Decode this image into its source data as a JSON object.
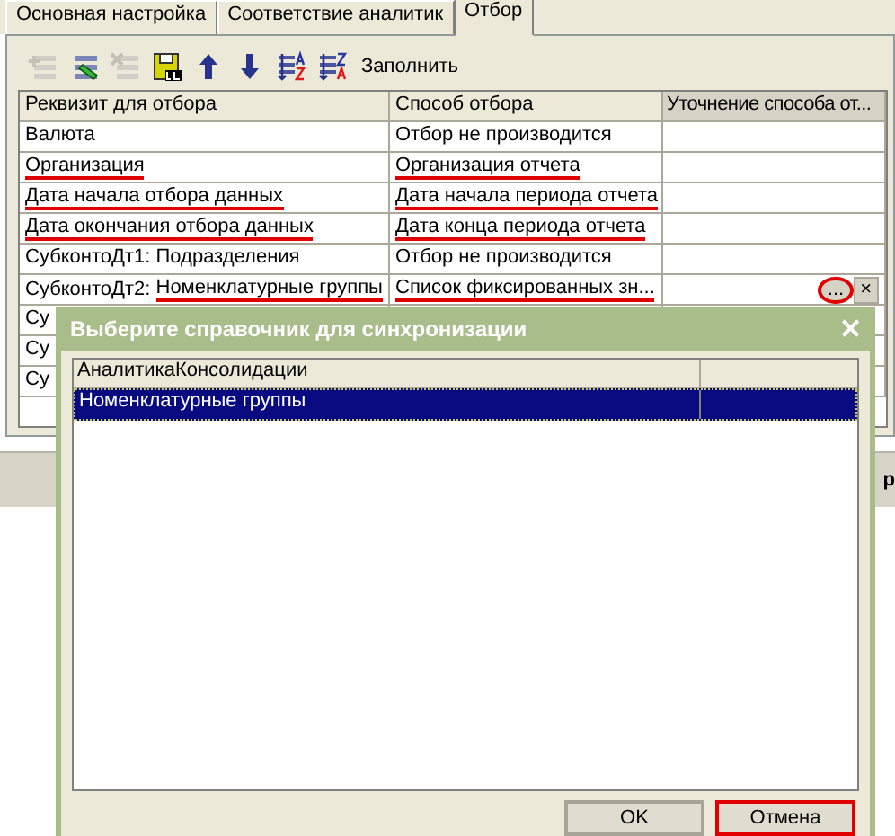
{
  "tabs": [
    {
      "label": "Основная настройка",
      "selected": false
    },
    {
      "label": "Соответствие аналитик",
      "selected": false
    },
    {
      "label": "Отбор",
      "selected": true
    }
  ],
  "toolbar": {
    "buttons": [
      {
        "kind": "add",
        "disabled": true
      },
      {
        "kind": "edit",
        "disabled": false
      },
      {
        "kind": "delete",
        "disabled": true
      },
      {
        "kind": "save",
        "disabled": false
      },
      {
        "kind": "up",
        "disabled": false
      },
      {
        "kind": "down",
        "disabled": false
      },
      {
        "kind": "sort_asc",
        "disabled": false
      },
      {
        "kind": "sort_desc",
        "disabled": false
      }
    ],
    "fill_label": "Заполнить"
  },
  "table": {
    "columns": [
      "Реквизит для отбора",
      "Способ отбора",
      "Уточнение способа от..."
    ],
    "rows": [
      {
        "cells": [
          {
            "text": "Валюта",
            "underlined": false
          },
          {
            "text": "Отбор не производится",
            "underlined": false
          }
        ]
      },
      {
        "cells": [
          {
            "text": "Организация",
            "underlined": true
          },
          {
            "text": "Организация отчета",
            "underlined": true
          }
        ]
      },
      {
        "cells": [
          {
            "text": "Дата начала отбора данных",
            "underlined": true
          },
          {
            "text": "Дата начала периода отчета",
            "underlined": true
          }
        ]
      },
      {
        "cells": [
          {
            "text": "Дата окончания отбора данных",
            "underlined": true
          },
          {
            "text": "Дата конца периода отчета",
            "underlined": true
          }
        ]
      },
      {
        "cells": [
          {
            "text": "СубконтоДт1: Подразделения",
            "underlined": false
          },
          {
            "text": "Отбор не производится",
            "underlined": false
          }
        ]
      },
      {
        "cells": [
          {
            "prefix": "СубконтоДт2:",
            "text": "Номенклатурные группы",
            "underlined": true
          },
          {
            "text": "Список фиксированных зн...",
            "underlined": true
          }
        ],
        "edit_buttons": {
          "choose": "...",
          "clear": "×",
          "circled": true
        }
      },
      {
        "cells": [
          {
            "text": "Су"
          }
        ]
      },
      {
        "cells": [
          {
            "text": "Су"
          }
        ]
      },
      {
        "cells": [
          {
            "text": "Су"
          }
        ]
      }
    ]
  },
  "bottom_bar": {
    "text": "р"
  },
  "dialog": {
    "title": "Выберите справочник для синхронизации",
    "close": "✕",
    "list": {
      "columns": [
        "АналитикаКонсолидации"
      ],
      "rows": [
        {
          "text": "Номенклатурные группы",
          "selected": true
        }
      ]
    },
    "buttons": [
      {
        "label": "OK",
        "highlighted": false
      },
      {
        "label": "Отмена",
        "highlighted": true
      }
    ]
  }
}
